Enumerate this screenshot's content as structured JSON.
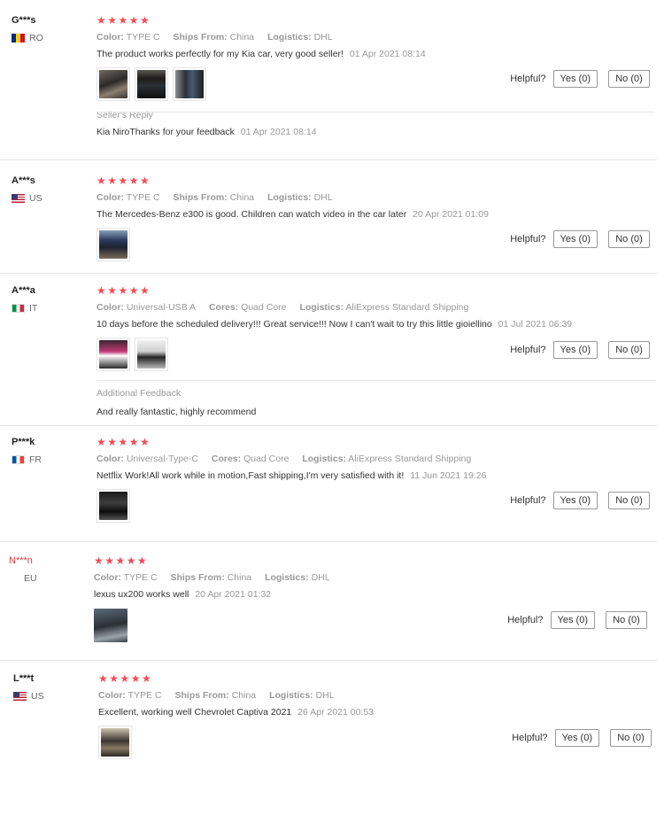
{
  "labels": {
    "color": "Color:",
    "ships_from": "Ships From:",
    "logistics": "Logistics:",
    "cores": "Cores:",
    "helpful": "Helpful?",
    "seller_reply": "Seller's Reply",
    "additional_feedback": "Additional Feedback"
  },
  "stars_glyph": "★★★★★",
  "reviews": [
    {
      "user": "G***s",
      "country": "RO",
      "rating": 5,
      "color": "TYPE C",
      "ships_from": "China",
      "logistics": "DHL",
      "text": "The product works perfectly for my Kia car, very good seller!",
      "date": "01 Apr 2021 08:14",
      "yes": "Yes (0)",
      "no": "No (0)",
      "reply_text": "Kia NiroThanks for your feedback",
      "reply_date": "01 Apr 2021 08:14"
    },
    {
      "user": "A***s",
      "country": "US",
      "rating": 5,
      "color": "TYPE C",
      "ships_from": "China",
      "logistics": "DHL",
      "text": "The Mercedes-Benz e300 is good. Children can watch video in the car later",
      "date": "20 Apr 2021 01:09",
      "yes": "Yes (0)",
      "no": "No (0)"
    },
    {
      "user": "A***a",
      "country": "IT",
      "rating": 5,
      "color": "Universal-USB A",
      "cores": "Quad Core",
      "logistics": "AliExpress Standard Shipping",
      "text": "10 days before the scheduled delivery!!! Great service!!! Now I can't wait to try this little gioiellino",
      "date": "01 Jul 2021 06:39",
      "yes": "Yes (0)",
      "no": "No (0)",
      "additional_text": "And really fantastic, highly recommend"
    },
    {
      "user": "P***k",
      "country": "FR",
      "rating": 5,
      "color": "Universal-Type-C",
      "cores": "Quad Core",
      "logistics": "AliExpress Standard Shipping",
      "text": "Netflix Work!All work while in motion,Fast shipping,I'm very satisfied with it!",
      "date": "11 Jun 2021 19:26",
      "yes": "Yes (0)",
      "no": "No (0)"
    },
    {
      "user": "N***n",
      "country": "EU",
      "rating": 5,
      "color": "TYPE C",
      "ships_from": "China",
      "logistics": "DHL",
      "text": "lexus ux200 works well",
      "date": "20 Apr 2021 01:32",
      "yes": "Yes (0)",
      "no": "No (0)"
    },
    {
      "user": "L***t",
      "country": "US",
      "rating": 5,
      "color": "TYPE C",
      "ships_from": "China",
      "logistics": "DHL",
      "text": "Excellent, working well Chevrolet Captiva 2021",
      "date": "26 Apr 2021 00:53",
      "yes": "Yes (0)",
      "no": "No (0)"
    }
  ]
}
